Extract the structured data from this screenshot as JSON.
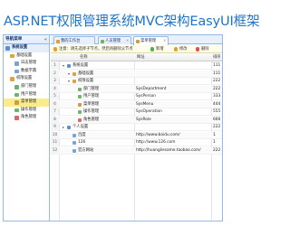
{
  "app_title": "ASP.NET权限管理系统MVC架构EasyUI框架",
  "sidebar": {
    "header": "导航菜单",
    "collapse_glyph": "«",
    "items": [
      {
        "label": "系统设置",
        "level": 0,
        "type": "group",
        "color": "#5a8fd8"
      },
      {
        "label": "基础设置",
        "level": 1,
        "type": "item",
        "color": "#d9a441"
      },
      {
        "label": "日志管理",
        "level": 2,
        "type": "item",
        "color": "#7aa3d6"
      },
      {
        "label": "数据字典",
        "level": 2,
        "type": "item",
        "color": "#7aa3d6"
      },
      {
        "label": "权限设置",
        "level": 1,
        "type": "item",
        "color": "#d9a441"
      },
      {
        "label": "部门管理",
        "level": 2,
        "type": "item",
        "color": "#6fb36f"
      },
      {
        "label": "用户管理",
        "level": 2,
        "type": "item",
        "color": "#6fb36f"
      },
      {
        "label": "菜单管理",
        "level": 2,
        "type": "item",
        "color": "#c9a040",
        "selected": true
      },
      {
        "label": "操作管理",
        "level": 2,
        "type": "item",
        "color": "#6fb36f"
      },
      {
        "label": "角色管理",
        "level": 2,
        "type": "item",
        "color": "#d46a6a"
      }
    ]
  },
  "tabs": [
    {
      "label": "我的工作台",
      "color": "#e0a030",
      "active": false,
      "closable": false
    },
    {
      "label": "人员管理",
      "color": "#6fb36f",
      "active": false,
      "closable": true
    },
    {
      "label": "菜单管理",
      "color": "#c9a040",
      "active": true,
      "closable": true
    }
  ],
  "tab_close_glyph": "×",
  "toolbar": {
    "hint": "注意：请先选择子节点，然后再删除父节点",
    "buttons": [
      {
        "label": "新增",
        "color": "#4caf50"
      },
      {
        "label": "修改",
        "color": "#e0a030"
      },
      {
        "label": "删除",
        "color": "#d9534f"
      }
    ]
  },
  "grid": {
    "columns": {
      "name": "名称",
      "url": "网址",
      "sort": "排序"
    },
    "rows": [
      {
        "num": "1",
        "level": 0,
        "toggle": "▾",
        "name": "系统设置",
        "url": "",
        "sort": "111",
        "color": "#5a8fd8"
      },
      {
        "num": "2",
        "level": 1,
        "toggle": "▾",
        "name": "基础设置",
        "url": "",
        "sort": "111",
        "color": "#d9a441"
      },
      {
        "num": "3",
        "level": 1,
        "toggle": "▾",
        "name": "权限设置",
        "url": "",
        "sort": "222",
        "color": "#d9a441"
      },
      {
        "num": "4",
        "level": 2,
        "toggle": "",
        "name": "部门管理",
        "url": "SysDepartment",
        "sort": "222",
        "color": "#6fb36f"
      },
      {
        "num": "5",
        "level": 2,
        "toggle": "",
        "name": "用户管理",
        "url": "SysPerson",
        "sort": "333",
        "color": "#6fb36f"
      },
      {
        "num": "6",
        "level": 2,
        "toggle": "",
        "name": "菜单管理",
        "url": "SysMenu",
        "sort": "444",
        "color": "#c9a040"
      },
      {
        "num": "7",
        "level": 2,
        "toggle": "",
        "name": "操作管理",
        "url": "SysOperation",
        "sort": "555",
        "color": "#6fb36f"
      },
      {
        "num": "8",
        "level": 2,
        "toggle": "",
        "name": "角色管理",
        "url": "SysRole",
        "sort": "666",
        "color": "#d46a6a"
      },
      {
        "num": "9",
        "level": 0,
        "toggle": "▸",
        "name": "个人设置",
        "url": "",
        "sort": "222",
        "color": "#5a8fd8"
      },
      {
        "num": "10",
        "level": 1,
        "toggle": "",
        "name": "百度",
        "url": "http://www.baidu.com/",
        "sort": "1",
        "color": "#7aa3d6"
      },
      {
        "num": "11",
        "level": 1,
        "toggle": "",
        "name": "126",
        "url": "http://www.126.com",
        "sort": "1",
        "color": "#7aa3d6"
      },
      {
        "num": "12",
        "level": 1,
        "toggle": "",
        "name": "官方网站",
        "url": "http://huangliesame.taobao.com/",
        "sort": "222",
        "color": "#7aa3d6"
      }
    ]
  }
}
